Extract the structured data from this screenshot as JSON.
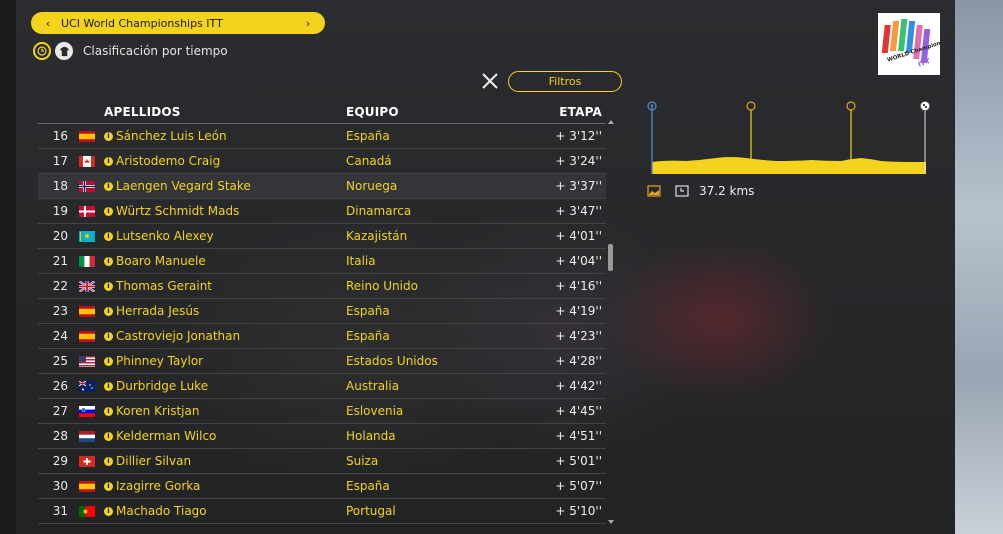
{
  "race": {
    "title": "UCI World Championships ITT",
    "prev_arrow": "‹",
    "next_arrow": "›"
  },
  "classification": {
    "label": "Clasificación por tiempo",
    "icons": [
      "clock-icon",
      "jersey-icon"
    ]
  },
  "filters": {
    "close_symbol": "×",
    "button_label": "Filtros"
  },
  "table": {
    "headers": {
      "name": "APELLIDOS",
      "team": "EQUIPO",
      "stage": "ETAPA"
    },
    "rows": [
      {
        "pos": "16",
        "flag": "es",
        "name": "Sánchez Luis León",
        "team": "España",
        "gap": "+ 3'12''"
      },
      {
        "pos": "17",
        "flag": "ca",
        "name": "Aristodemo Craig",
        "team": "Canadá",
        "gap": "+ 3'24''"
      },
      {
        "pos": "18",
        "flag": "no",
        "name": "Laengen Vegard Stake",
        "team": "Noruega",
        "gap": "+ 3'37''"
      },
      {
        "pos": "19",
        "flag": "dk",
        "name": "Würtz Schmidt Mads",
        "team": "Dinamarca",
        "gap": "+ 3'47''"
      },
      {
        "pos": "20",
        "flag": "kz",
        "name": "Lutsenko Alexey",
        "team": "Kazajistán",
        "gap": "+ 4'01''"
      },
      {
        "pos": "21",
        "flag": "it",
        "name": "Boaro Manuele",
        "team": "Italia",
        "gap": "+ 4'04''"
      },
      {
        "pos": "22",
        "flag": "gb",
        "name": "Thomas Geraint",
        "team": "Reino Unido",
        "gap": "+ 4'16''"
      },
      {
        "pos": "23",
        "flag": "es",
        "name": "Herrada Jesús",
        "team": "España",
        "gap": "+ 4'19''"
      },
      {
        "pos": "24",
        "flag": "es",
        "name": "Castroviejo Jonathan",
        "team": "España",
        "gap": "+ 4'23''"
      },
      {
        "pos": "25",
        "flag": "us",
        "name": "Phinney Taylor",
        "team": "Estados Unidos",
        "gap": "+ 4'28''"
      },
      {
        "pos": "26",
        "flag": "au",
        "name": "Durbridge Luke",
        "team": "Australia",
        "gap": "+ 4'42''"
      },
      {
        "pos": "27",
        "flag": "si",
        "name": "Koren Kristjan",
        "team": "Eslovenia",
        "gap": "+ 4'45''"
      },
      {
        "pos": "28",
        "flag": "nl",
        "name": "Kelderman Wilco",
        "team": "Holanda",
        "gap": "+ 4'51''"
      },
      {
        "pos": "29",
        "flag": "ch",
        "name": "Dillier Silvan",
        "team": "Suiza",
        "gap": "+ 5'01''"
      },
      {
        "pos": "30",
        "flag": "es",
        "name": "Izagirre Gorka",
        "team": "España",
        "gap": "+ 5'07''"
      },
      {
        "pos": "31",
        "flag": "pt",
        "name": "Machado Tiago",
        "team": "Portugal",
        "gap": "+ 5'10''"
      }
    ]
  },
  "stage_profile": {
    "distance": "37.2 kms",
    "markers": [
      "start-icon",
      "time-check-icon",
      "time-check-icon",
      "finish-flag-icon"
    ]
  },
  "logo": {
    "line1": "WORLD Championships",
    "line2": "ITT"
  },
  "colors": {
    "accent": "#f3d31c",
    "profile_line": "#4a90d9"
  }
}
